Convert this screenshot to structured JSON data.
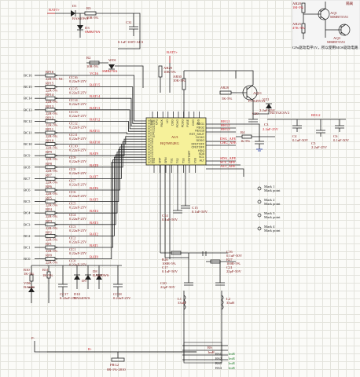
{
  "ic": {
    "ref": "AU1",
    "part": "BQ76952EG"
  },
  "battery_net": "BATT+",
  "top_diode": {
    "ref": "D1",
    "part": "BAS40WS"
  },
  "top_resistor": {
    "ref": "R3",
    "value": "10R-5%"
  },
  "zener": {
    "ref": "D3",
    "part": "SMBJ70A"
  },
  "top_cap": {
    "ref": "C31",
    "value": "0.1uF-100V-AC3"
  },
  "wd1": {
    "ref": "WD1",
    "part": "SMBJ70A"
  },
  "r2": {
    "ref": "R2",
    "value": "10R-5%"
  },
  "ar29": {
    "ref": "AR29",
    "value": "10K-5%"
  },
  "ar30": {
    "ref": "AR30",
    "value": "10K-5%"
  },
  "fet": {
    "ref": "AQ11",
    "part": "FCX495TA"
  },
  "vz1": {
    "ref": "VZ1",
    "part": "BZT52C6V2"
  },
  "ar28": {
    "ref": "AR28",
    "value": "5K-5%"
  },
  "c20": {
    "ref": "C20",
    "value": "2.2uF-25V"
  },
  "c3": {
    "ref": "C3",
    "value": "2.2uF-25V"
  },
  "r4": {
    "ref": "R4",
    "value": "1k-5%"
  },
  "reg_nets": [
    "REG1",
    "REG2",
    "REG3"
  ],
  "reg2_label": "REG2",
  "c4": {
    "ref": "C4",
    "value": "0.1uF-50V"
  },
  "c5": {
    "ref": "C5",
    "value": "2.2uF-25V"
  },
  "c6": {
    "ref": "C6",
    "value": "0.1uF-50V"
  },
  "comm_nets": [
    "DSG_AFE",
    "CHG_AFE",
    "SDA_AFE",
    "SCL_AFE",
    "ALT_AFE"
  ],
  "cell_inputs": [
    {
      "bc": "BC16",
      "rp": "RP16",
      "rv": "22R-5% NC",
      "cc": "CC16",
      "cv": "0.22uF-25V",
      "net": "VC16"
    },
    {
      "bc": "BC15",
      "rp": "RP15",
      "rv": "22R-5%",
      "cc": "CC15",
      "cv": "0.22uF-25V",
      "net": "BAT15"
    },
    {
      "bc": "BC14",
      "rp": "RP14",
      "rv": "22R-5%",
      "cc": "CC14",
      "cv": "0.22uF-25V",
      "net": "BAT14"
    },
    {
      "bc": "BC13",
      "rp": "RP13",
      "rv": "22R-5%",
      "cc": "CC13",
      "cv": "0.22uF-25V",
      "net": "BAT13"
    },
    {
      "bc": "BC12",
      "rp": "RP12",
      "rv": "22R-5%",
      "cc": "CC12",
      "cv": "0.22uF-25V",
      "net": "BAT12"
    },
    {
      "bc": "BC11",
      "rp": "RP11",
      "rv": "22R-5%",
      "cc": "CC11",
      "cv": "0.22uF-25V",
      "net": "BAT11"
    },
    {
      "bc": "BC10",
      "rp": "RP10",
      "rv": "22R-5%",
      "cc": "CC10",
      "cv": "0.22uF-25V",
      "net": "BAT10"
    },
    {
      "bc": "BC9",
      "rp": "RP9",
      "rv": "22R-5%",
      "cc": "CC9",
      "cv": "0.22uF-25V",
      "net": "BAT9"
    },
    {
      "bc": "BC8",
      "rp": "RP8",
      "rv": "22R-5%",
      "cc": "CC8",
      "cv": "0.22uF-25V",
      "net": "BAT8"
    },
    {
      "bc": "BC7",
      "rp": "RP7",
      "rv": "22R-5%",
      "cc": "CC7",
      "cv": "0.22uF-25V",
      "net": "BAT7"
    },
    {
      "bc": "BC6",
      "rp": "RP6",
      "rv": "22R-5%",
      "cc": "CC6",
      "cv": "0.22uF-25V",
      "net": "BAT6"
    },
    {
      "bc": "BC5",
      "rp": "RP5",
      "rv": "22R-5%",
      "cc": "CC5",
      "cv": "0.22uF-25V",
      "net": "BAT5"
    },
    {
      "bc": "BC4",
      "rp": "RP4",
      "rv": "22R-5%",
      "cc": "CC4",
      "cv": "0.22uF-25V",
      "net": "BAT4"
    },
    {
      "bc": "BC3",
      "rp": "RP3",
      "rv": "22R-5%",
      "cc": "CC3",
      "cv": "0.22uF-25V",
      "net": "BAT3"
    },
    {
      "bc": "BC2",
      "rp": "RP2",
      "rv": "22R-5%",
      "cc": "CC2",
      "cv": "0.22uF-25V",
      "net": "BAT2"
    },
    {
      "bc": "BC1",
      "rp": "RP1",
      "rv": "22R-5%",
      "cc": "CC1",
      "cv": "0.22uF-25V",
      "net": "BAT1"
    },
    {
      "bc": "BC0",
      "rp": "RP0",
      "rv": "22R-5%",
      "cc": "CC0",
      "cv": "0.22uF-25V",
      "net": "BAT0"
    }
  ],
  "pins_left": [
    "VC16",
    "VC15",
    "VC14",
    "VC13",
    "VC12",
    "VC11",
    "VC10",
    "VC9",
    "VC8",
    "VC7",
    "VC6",
    "VC5",
    "VC4",
    "VC3",
    "VC2",
    "VC1",
    "VC0"
  ],
  "pins_right": [
    "REG1",
    "REG2",
    "REG18",
    "RST_SHUT",
    "DCHG",
    "DDSG",
    "DFETOFF",
    "CFETOFF",
    "HDQ",
    "SDA",
    "SCL",
    "ALT"
  ],
  "pins_top": [
    "BAT",
    "CP1",
    "PACK",
    "LD",
    "DSG",
    "PCHG",
    "PDSG",
    "FUSE",
    "CHG",
    "VSS"
  ],
  "pins_bottom": [
    "VSS",
    "SRP",
    "SRN",
    "TS1",
    "TS2",
    "TS3",
    "CFETOFF",
    "VSS"
  ],
  "bottom_parts": {
    "r30": {
      "ref": "R30",
      "value": "1K-5%"
    },
    "r31": {
      "ref": "R31",
      "value": "1K-5%"
    },
    "vd6": {
      "ref": "VD6",
      "part": "BAS40"
    },
    "cc17": {
      "ref": "CC17",
      "value": "0.22uF-25V"
    },
    "d10": {
      "ref": "D10",
      "part": "BAS40WS"
    },
    "d9": {
      "ref": "D9",
      "part": "BAS40WS"
    },
    "d8": {
      "ref": "D8",
      "part": "BAS40WS"
    },
    "cc18": {
      "ref": "CC18",
      "value": "0.22uF-25V"
    }
  },
  "sense": {
    "r26": {
      "ref": "R26",
      "value": "100R-5%"
    },
    "r27": {
      "ref": "R27",
      "value": "100R-5%"
    },
    "c17": {
      "ref": "C17",
      "value": "0.1uF-50V"
    },
    "c16": {
      "ref": "C16",
      "value": "0.1uF-50V"
    },
    "c20b": {
      "ref": "C20",
      "value": "22pF-50V"
    },
    "c21": {
      "ref": "C21",
      "value": "22pF-50V"
    },
    "l1": {
      "ref": "L1",
      "value": "33uH"
    },
    "l2": {
      "ref": "L2",
      "value": "33uH"
    },
    "rsh": {
      "ref": "RSH",
      "value": "1mR"
    }
  },
  "ts_parts": {
    "c14": {
      "ref": "C14",
      "value": "0.1uF-50V"
    },
    "c15": {
      "ref": "C15",
      "value": "0.1uF-50V"
    }
  },
  "marks": [
    {
      "label": "Mark 1",
      "sub": "Mark point"
    },
    {
      "label": "Mark 2",
      "sub": "Mark point"
    },
    {
      "label": "Mark 3",
      "sub": "Mark point"
    },
    {
      "label": "Mark 4",
      "sub": "Mark point"
    }
  ],
  "shunts": [
    {
      "ref": "RS1",
      "value": "1mR"
    },
    {
      "ref": "RS2",
      "value": "1mR"
    },
    {
      "ref": "RS3",
      "value": "1mR"
    },
    {
      "ref": "RS4",
      "value": "1mR"
    }
  ],
  "rs_main": {
    "ref": "RS",
    "value": "1mR"
  },
  "prg": {
    "ref": "PRG2",
    "value": "0R-1%-2010"
  },
  "p_net": "P-",
  "b_net": "B-",
  "corner": {
    "ar20": {
      "ref": "AR20",
      "value": "1M-5%"
    },
    "ar25": {
      "ref": "AR25",
      "value": "47K-5%"
    },
    "q1": {
      "ref": "AQ1",
      "part": "MMBT5551"
    },
    "q2": {
      "ref": "AQ3",
      "part": "MMBT5551"
    },
    "note": "GPu驱动电平5V，所以使用MOS驱动电路",
    "side": "隔离"
  },
  "colors": {
    "wire": "#202020",
    "label": "#7a1010",
    "net": "#c4151c",
    "chip": "#f6f19a",
    "gnd": "#1b35a8"
  }
}
